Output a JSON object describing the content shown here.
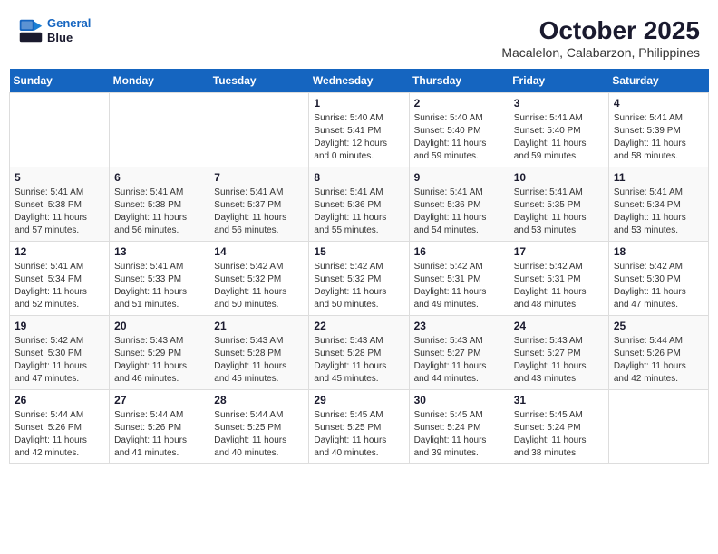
{
  "header": {
    "logo_line1": "General",
    "logo_line2": "Blue",
    "month": "October 2025",
    "location": "Macalelon, Calabarzon, Philippines"
  },
  "weekdays": [
    "Sunday",
    "Monday",
    "Tuesday",
    "Wednesday",
    "Thursday",
    "Friday",
    "Saturday"
  ],
  "weeks": [
    [
      {
        "day": "",
        "info": ""
      },
      {
        "day": "",
        "info": ""
      },
      {
        "day": "",
        "info": ""
      },
      {
        "day": "1",
        "info": "Sunrise: 5:40 AM\nSunset: 5:41 PM\nDaylight: 12 hours\nand 0 minutes."
      },
      {
        "day": "2",
        "info": "Sunrise: 5:40 AM\nSunset: 5:40 PM\nDaylight: 11 hours\nand 59 minutes."
      },
      {
        "day": "3",
        "info": "Sunrise: 5:41 AM\nSunset: 5:40 PM\nDaylight: 11 hours\nand 59 minutes."
      },
      {
        "day": "4",
        "info": "Sunrise: 5:41 AM\nSunset: 5:39 PM\nDaylight: 11 hours\nand 58 minutes."
      }
    ],
    [
      {
        "day": "5",
        "info": "Sunrise: 5:41 AM\nSunset: 5:38 PM\nDaylight: 11 hours\nand 57 minutes."
      },
      {
        "day": "6",
        "info": "Sunrise: 5:41 AM\nSunset: 5:38 PM\nDaylight: 11 hours\nand 56 minutes."
      },
      {
        "day": "7",
        "info": "Sunrise: 5:41 AM\nSunset: 5:37 PM\nDaylight: 11 hours\nand 56 minutes."
      },
      {
        "day": "8",
        "info": "Sunrise: 5:41 AM\nSunset: 5:36 PM\nDaylight: 11 hours\nand 55 minutes."
      },
      {
        "day": "9",
        "info": "Sunrise: 5:41 AM\nSunset: 5:36 PM\nDaylight: 11 hours\nand 54 minutes."
      },
      {
        "day": "10",
        "info": "Sunrise: 5:41 AM\nSunset: 5:35 PM\nDaylight: 11 hours\nand 53 minutes."
      },
      {
        "day": "11",
        "info": "Sunrise: 5:41 AM\nSunset: 5:34 PM\nDaylight: 11 hours\nand 53 minutes."
      }
    ],
    [
      {
        "day": "12",
        "info": "Sunrise: 5:41 AM\nSunset: 5:34 PM\nDaylight: 11 hours\nand 52 minutes."
      },
      {
        "day": "13",
        "info": "Sunrise: 5:41 AM\nSunset: 5:33 PM\nDaylight: 11 hours\nand 51 minutes."
      },
      {
        "day": "14",
        "info": "Sunrise: 5:42 AM\nSunset: 5:32 PM\nDaylight: 11 hours\nand 50 minutes."
      },
      {
        "day": "15",
        "info": "Sunrise: 5:42 AM\nSunset: 5:32 PM\nDaylight: 11 hours\nand 50 minutes."
      },
      {
        "day": "16",
        "info": "Sunrise: 5:42 AM\nSunset: 5:31 PM\nDaylight: 11 hours\nand 49 minutes."
      },
      {
        "day": "17",
        "info": "Sunrise: 5:42 AM\nSunset: 5:31 PM\nDaylight: 11 hours\nand 48 minutes."
      },
      {
        "day": "18",
        "info": "Sunrise: 5:42 AM\nSunset: 5:30 PM\nDaylight: 11 hours\nand 47 minutes."
      }
    ],
    [
      {
        "day": "19",
        "info": "Sunrise: 5:42 AM\nSunset: 5:30 PM\nDaylight: 11 hours\nand 47 minutes."
      },
      {
        "day": "20",
        "info": "Sunrise: 5:43 AM\nSunset: 5:29 PM\nDaylight: 11 hours\nand 46 minutes."
      },
      {
        "day": "21",
        "info": "Sunrise: 5:43 AM\nSunset: 5:28 PM\nDaylight: 11 hours\nand 45 minutes."
      },
      {
        "day": "22",
        "info": "Sunrise: 5:43 AM\nSunset: 5:28 PM\nDaylight: 11 hours\nand 45 minutes."
      },
      {
        "day": "23",
        "info": "Sunrise: 5:43 AM\nSunset: 5:27 PM\nDaylight: 11 hours\nand 44 minutes."
      },
      {
        "day": "24",
        "info": "Sunrise: 5:43 AM\nSunset: 5:27 PM\nDaylight: 11 hours\nand 43 minutes."
      },
      {
        "day": "25",
        "info": "Sunrise: 5:44 AM\nSunset: 5:26 PM\nDaylight: 11 hours\nand 42 minutes."
      }
    ],
    [
      {
        "day": "26",
        "info": "Sunrise: 5:44 AM\nSunset: 5:26 PM\nDaylight: 11 hours\nand 42 minutes."
      },
      {
        "day": "27",
        "info": "Sunrise: 5:44 AM\nSunset: 5:26 PM\nDaylight: 11 hours\nand 41 minutes."
      },
      {
        "day": "28",
        "info": "Sunrise: 5:44 AM\nSunset: 5:25 PM\nDaylight: 11 hours\nand 40 minutes."
      },
      {
        "day": "29",
        "info": "Sunrise: 5:45 AM\nSunset: 5:25 PM\nDaylight: 11 hours\nand 40 minutes."
      },
      {
        "day": "30",
        "info": "Sunrise: 5:45 AM\nSunset: 5:24 PM\nDaylight: 11 hours\nand 39 minutes."
      },
      {
        "day": "31",
        "info": "Sunrise: 5:45 AM\nSunset: 5:24 PM\nDaylight: 11 hours\nand 38 minutes."
      },
      {
        "day": "",
        "info": ""
      }
    ]
  ]
}
